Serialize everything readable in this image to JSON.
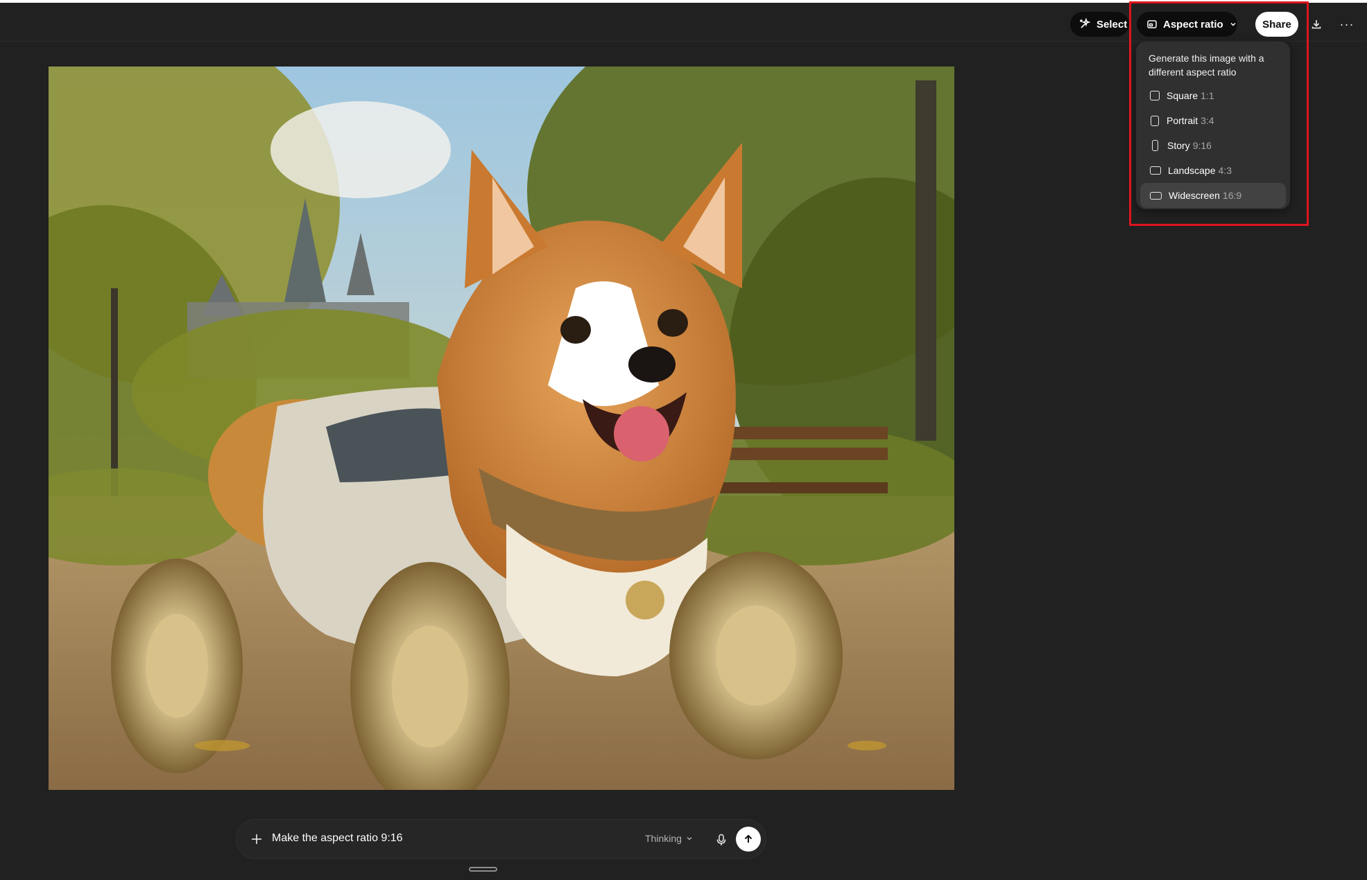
{
  "header": {
    "select_label": "Select",
    "aspect_label": "Aspect ratio",
    "share_label": "Share",
    "more_label": "···"
  },
  "dropdown": {
    "title": "Generate this image with a different aspect ratio",
    "options": [
      {
        "label": "Square",
        "ratio": "1:1"
      },
      {
        "label": "Portrait",
        "ratio": "3:4"
      },
      {
        "label": "Story",
        "ratio": "9:16"
      },
      {
        "label": "Landscape",
        "ratio": "4:3"
      },
      {
        "label": "Widescreen",
        "ratio": "16:9"
      }
    ],
    "selected": "Widescreen"
  },
  "composer": {
    "message": "Make the aspect ratio 9:16",
    "model": "Thinking"
  },
  "colors": {
    "background": "#212121",
    "highlight": "#e0141e",
    "dropdown_bg": "#303030"
  },
  "icons": [
    "select-sparkle-icon",
    "aspect-ratio-icon",
    "chevron-down-icon",
    "download-icon",
    "more-icon",
    "plus-icon",
    "mic-icon",
    "arrow-up-icon"
  ]
}
